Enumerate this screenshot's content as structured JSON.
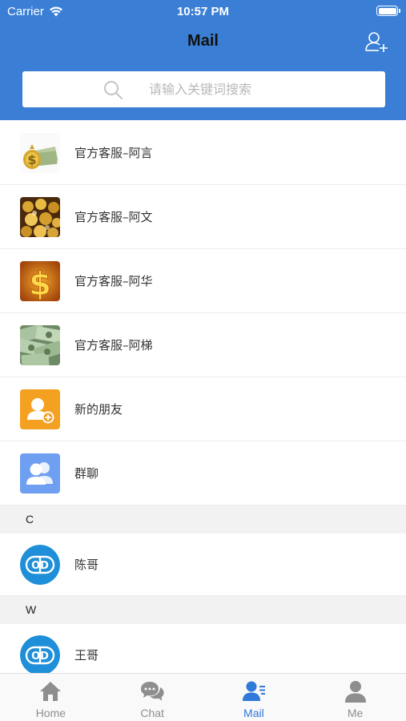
{
  "status_bar": {
    "carrier": "Carrier",
    "time": "10:57 PM"
  },
  "nav": {
    "title": "Mail"
  },
  "search": {
    "placeholder": "请输入关键词搜索"
  },
  "rows": [
    {
      "label": "官方客服–阿言",
      "avatar": "money-stack-avatar"
    },
    {
      "label": "官方客服–阿文",
      "avatar": "gold-coins-avatar"
    },
    {
      "label": "官方客服–阿华",
      "avatar": "dollar-sign-avatar"
    },
    {
      "label": "官方客服–阿梯",
      "avatar": "cash-bills-avatar"
    },
    {
      "label": "新的朋友",
      "avatar": "new-friend-icon"
    },
    {
      "label": "群聊",
      "avatar": "group-chat-icon"
    }
  ],
  "sections": [
    {
      "letter": "C",
      "contacts": [
        {
          "name": "陈哥"
        }
      ]
    },
    {
      "letter": "W",
      "contacts": [
        {
          "name": "王哥"
        }
      ]
    }
  ],
  "contact_avatar_text": "OD",
  "tabs": [
    {
      "label": "Home",
      "icon": "home-icon",
      "active": false
    },
    {
      "label": "Chat",
      "icon": "chat-bubbles-icon",
      "active": false
    },
    {
      "label": "Mail",
      "icon": "contacts-icon",
      "active": true
    },
    {
      "label": "Me",
      "icon": "person-icon",
      "active": false
    }
  ],
  "colors": {
    "header": "#3a7fd5",
    "active_tab": "#2f7ad8",
    "inactive_tab": "#8e8e8e",
    "orange": "#f4a020",
    "blue_icon": "#6e9ff0"
  }
}
